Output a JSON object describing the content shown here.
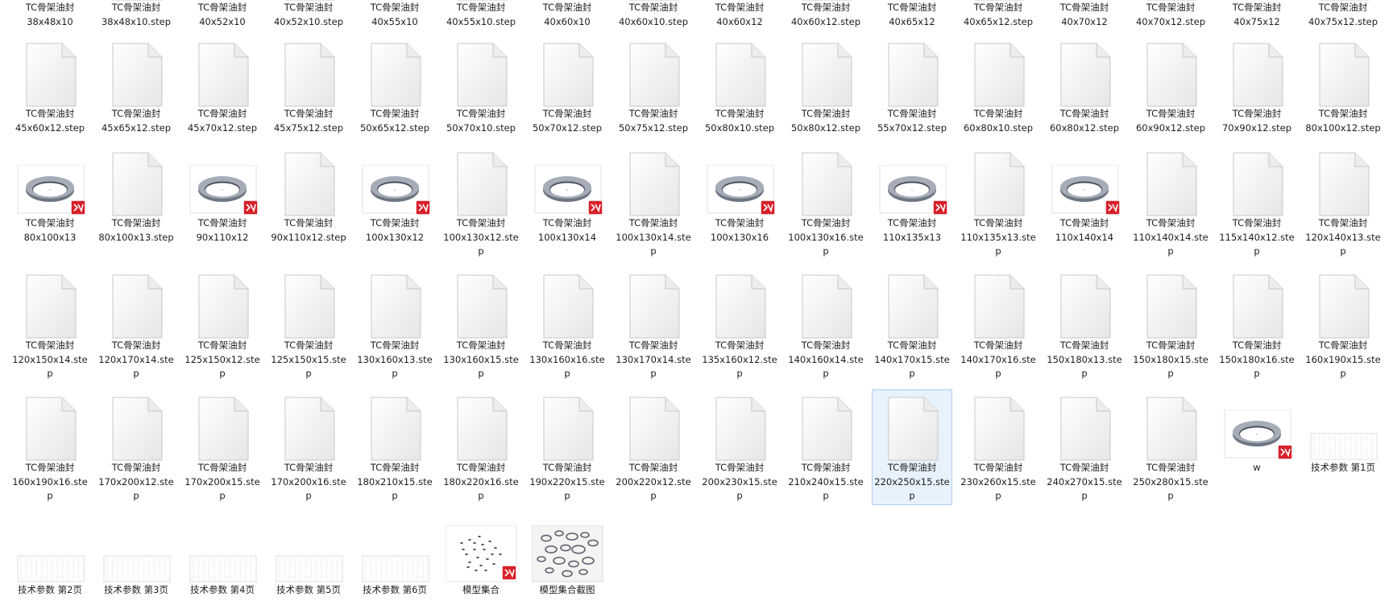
{
  "rows": [
    [
      {
        "kind": "sw",
        "l1": "TC骨架油封",
        "l2": "38x48x10"
      },
      {
        "kind": "doc",
        "l1": "TC骨架油封",
        "l2": "38x48x10.step"
      },
      {
        "kind": "sw",
        "l1": "TC骨架油封",
        "l2": "40x52x10"
      },
      {
        "kind": "doc",
        "l1": "TC骨架油封",
        "l2": "40x52x10.step"
      },
      {
        "kind": "sw",
        "l1": "TC骨架油封",
        "l2": "40x55x10"
      },
      {
        "kind": "doc",
        "l1": "TC骨架油封",
        "l2": "40x55x10.step"
      },
      {
        "kind": "sw",
        "l1": "TC骨架油封",
        "l2": "40x60x10"
      },
      {
        "kind": "doc",
        "l1": "TC骨架油封",
        "l2": "40x60x10.step"
      },
      {
        "kind": "sw",
        "l1": "TC骨架油封",
        "l2": "40x60x12"
      },
      {
        "kind": "doc",
        "l1": "TC骨架油封",
        "l2": "40x60x12.step"
      },
      {
        "kind": "sw",
        "l1": "TC骨架油封",
        "l2": "40x65x12"
      },
      {
        "kind": "doc",
        "l1": "TC骨架油封",
        "l2": "40x65x12.step"
      },
      {
        "kind": "sw",
        "l1": "TC骨架油封",
        "l2": "40x70x12"
      },
      {
        "kind": "doc",
        "l1": "TC骨架油封",
        "l2": "40x70x12.step"
      },
      {
        "kind": "sw",
        "l1": "TC骨架油封",
        "l2": "40x75x12"
      },
      {
        "kind": "doc",
        "l1": "TC骨架油封",
        "l2": "40x75x12.step"
      }
    ],
    [
      {
        "kind": "doc",
        "l1": "TC骨架油封",
        "l2": "45x60x12.step"
      },
      {
        "kind": "doc",
        "l1": "TC骨架油封",
        "l2": "45x65x12.step"
      },
      {
        "kind": "doc",
        "l1": "TC骨架油封",
        "l2": "45x70x12.step"
      },
      {
        "kind": "doc",
        "l1": "TC骨架油封",
        "l2": "45x75x12.step"
      },
      {
        "kind": "doc",
        "l1": "TC骨架油封",
        "l2": "50x65x12.step"
      },
      {
        "kind": "doc",
        "l1": "TC骨架油封",
        "l2": "50x70x10.step"
      },
      {
        "kind": "doc",
        "l1": "TC骨架油封",
        "l2": "50x70x12.step"
      },
      {
        "kind": "doc",
        "l1": "TC骨架油封",
        "l2": "50x75x12.step"
      },
      {
        "kind": "doc",
        "l1": "TC骨架油封",
        "l2": "50x80x10.step"
      },
      {
        "kind": "doc",
        "l1": "TC骨架油封",
        "l2": "50x80x12.step"
      },
      {
        "kind": "doc",
        "l1": "TC骨架油封",
        "l2": "55x70x12.step"
      },
      {
        "kind": "doc",
        "l1": "TC骨架油封",
        "l2": "60x80x10.step"
      },
      {
        "kind": "doc",
        "l1": "TC骨架油封",
        "l2": "60x80x12.step"
      },
      {
        "kind": "doc",
        "l1": "TC骨架油封",
        "l2": "60x90x12.step"
      },
      {
        "kind": "doc",
        "l1": "TC骨架油封",
        "l2": "70x90x12.step"
      },
      {
        "kind": "doc",
        "l1": "TC骨架油封",
        "l2": "80x100x12.step"
      }
    ],
    [
      {
        "kind": "sw",
        "l1": "TC骨架油封",
        "l2": "80x100x13"
      },
      {
        "kind": "doc",
        "l1": "TC骨架油封",
        "l2": "80x100x13.step"
      },
      {
        "kind": "sw",
        "l1": "TC骨架油封",
        "l2": "90x110x12"
      },
      {
        "kind": "doc",
        "l1": "TC骨架油封",
        "l2": "90x110x12.step"
      },
      {
        "kind": "sw",
        "l1": "TC骨架油封",
        "l2": "100x130x12"
      },
      {
        "kind": "doc",
        "l1": "TC骨架油封",
        "l2": "100x130x12.ste",
        "l3": "p"
      },
      {
        "kind": "sw",
        "l1": "TC骨架油封",
        "l2": "100x130x14"
      },
      {
        "kind": "doc",
        "l1": "TC骨架油封",
        "l2": "100x130x14.ste",
        "l3": "p"
      },
      {
        "kind": "sw",
        "l1": "TC骨架油封",
        "l2": "100x130x16"
      },
      {
        "kind": "doc",
        "l1": "TC骨架油封",
        "l2": "100x130x16.ste",
        "l3": "p"
      },
      {
        "kind": "sw",
        "l1": "TC骨架油封",
        "l2": "110x135x13"
      },
      {
        "kind": "doc",
        "l1": "TC骨架油封",
        "l2": "110x135x13.ste",
        "l3": "p"
      },
      {
        "kind": "sw",
        "l1": "TC骨架油封",
        "l2": "110x140x14"
      },
      {
        "kind": "doc",
        "l1": "TC骨架油封",
        "l2": "110x140x14.ste",
        "l3": "p"
      },
      {
        "kind": "doc",
        "l1": "TC骨架油封",
        "l2": "115x140x12.ste",
        "l3": "p"
      },
      {
        "kind": "doc",
        "l1": "TC骨架油封",
        "l2": "120x140x13.ste",
        "l3": "p"
      }
    ],
    [
      {
        "kind": "doc",
        "l1": "TC骨架油封",
        "l2": "120x150x14.ste",
        "l3": "p"
      },
      {
        "kind": "doc",
        "l1": "TC骨架油封",
        "l2": "120x170x14.ste",
        "l3": "p"
      },
      {
        "kind": "doc",
        "l1": "TC骨架油封",
        "l2": "125x150x12.ste",
        "l3": "p"
      },
      {
        "kind": "doc",
        "l1": "TC骨架油封",
        "l2": "125x150x15.ste",
        "l3": "p"
      },
      {
        "kind": "doc",
        "l1": "TC骨架油封",
        "l2": "130x160x13.ste",
        "l3": "p"
      },
      {
        "kind": "doc",
        "l1": "TC骨架油封",
        "l2": "130x160x15.ste",
        "l3": "p"
      },
      {
        "kind": "doc",
        "l1": "TC骨架油封",
        "l2": "130x160x16.ste",
        "l3": "p"
      },
      {
        "kind": "doc",
        "l1": "TC骨架油封",
        "l2": "130x170x14.ste",
        "l3": "p"
      },
      {
        "kind": "doc",
        "l1": "TC骨架油封",
        "l2": "135x160x12.ste",
        "l3": "p"
      },
      {
        "kind": "doc",
        "l1": "TC骨架油封",
        "l2": "140x160x14.ste",
        "l3": "p"
      },
      {
        "kind": "doc",
        "l1": "TC骨架油封",
        "l2": "140x170x15.ste",
        "l3": "p"
      },
      {
        "kind": "doc",
        "l1": "TC骨架油封",
        "l2": "140x170x16.ste",
        "l3": "p"
      },
      {
        "kind": "doc",
        "l1": "TC骨架油封",
        "l2": "150x180x13.ste",
        "l3": "p"
      },
      {
        "kind": "doc",
        "l1": "TC骨架油封",
        "l2": "150x180x15.ste",
        "l3": "p"
      },
      {
        "kind": "doc",
        "l1": "TC骨架油封",
        "l2": "150x180x16.ste",
        "l3": "p"
      },
      {
        "kind": "doc",
        "l1": "TC骨架油封",
        "l2": "160x190x15.ste",
        "l3": "p"
      }
    ],
    [
      {
        "kind": "doc",
        "l1": "TC骨架油封",
        "l2": "160x190x16.ste",
        "l3": "p"
      },
      {
        "kind": "doc",
        "l1": "TC骨架油封",
        "l2": "170x200x12.ste",
        "l3": "p"
      },
      {
        "kind": "doc",
        "l1": "TC骨架油封",
        "l2": "170x200x15.ste",
        "l3": "p"
      },
      {
        "kind": "doc",
        "l1": "TC骨架油封",
        "l2": "170x200x16.ste",
        "l3": "p"
      },
      {
        "kind": "doc",
        "l1": "TC骨架油封",
        "l2": "180x210x15.ste",
        "l3": "p"
      },
      {
        "kind": "doc",
        "l1": "TC骨架油封",
        "l2": "180x220x16.ste",
        "l3": "p"
      },
      {
        "kind": "doc",
        "l1": "TC骨架油封",
        "l2": "190x220x15.ste",
        "l3": "p"
      },
      {
        "kind": "doc",
        "l1": "TC骨架油封",
        "l2": "200x220x12.ste",
        "l3": "p"
      },
      {
        "kind": "doc",
        "l1": "TC骨架油封",
        "l2": "200x230x15.ste",
        "l3": "p"
      },
      {
        "kind": "doc",
        "l1": "TC骨架油封",
        "l2": "210x240x15.ste",
        "l3": "p"
      },
      {
        "kind": "doc",
        "l1": "TC骨架油封",
        "l2": "220x250x15.ste",
        "l3": "p",
        "selected": true
      },
      {
        "kind": "doc",
        "l1": "TC骨架油封",
        "l2": "230x260x15.ste",
        "l3": "p"
      },
      {
        "kind": "doc",
        "l1": "TC骨架油封",
        "l2": "240x270x15.ste",
        "l3": "p"
      },
      {
        "kind": "doc",
        "l1": "TC骨架油封",
        "l2": "250x280x15.ste",
        "l3": "p"
      },
      {
        "kind": "sw",
        "l1": "w"
      },
      {
        "kind": "sheet",
        "l1": "技术参数 第1页"
      }
    ],
    [
      {
        "kind": "sheet",
        "l1": "技术参数 第2页"
      },
      {
        "kind": "sheet",
        "l1": "技术参数 第3页"
      },
      {
        "kind": "sheet",
        "l1": "技术参数 第4页"
      },
      {
        "kind": "sheet",
        "l1": "技术参数 第5页"
      },
      {
        "kind": "sheet",
        "l1": "技术参数 第6页"
      },
      {
        "kind": "scatter",
        "l1": "模型集合"
      },
      {
        "kind": "photo",
        "l1": "模型集合截图"
      }
    ]
  ],
  "colors": {
    "selection_bg": "#e8f2fd",
    "selection_border": "#a9cdf2",
    "sw_badge": "#d7202a"
  }
}
